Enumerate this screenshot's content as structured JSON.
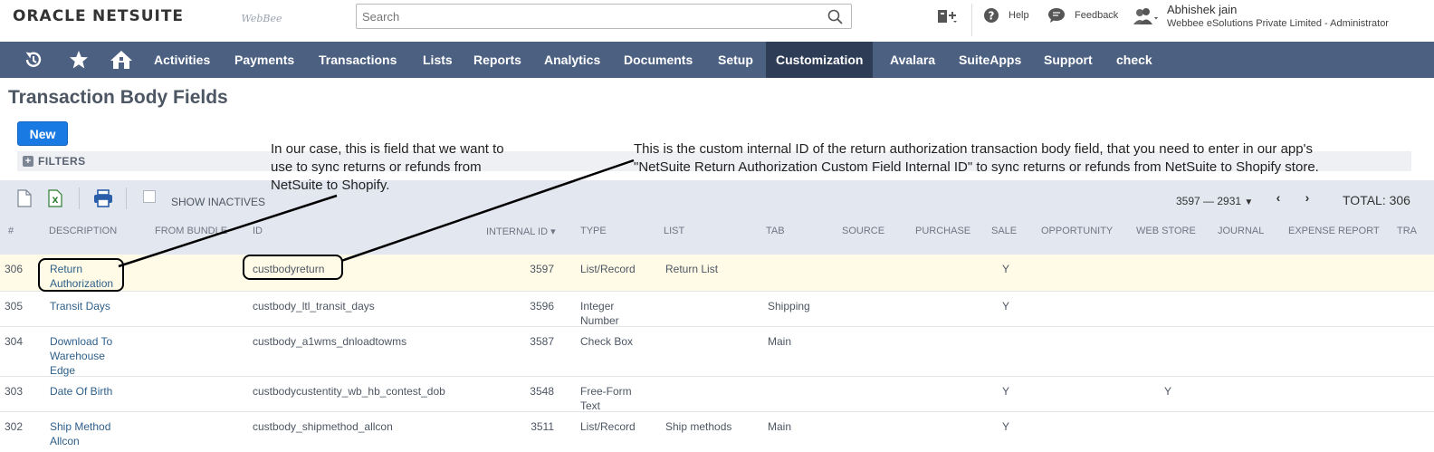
{
  "header": {
    "logo_bold": "ORACLE",
    "logo_light": "NETSUITE",
    "company_logo": "WebBee",
    "search_placeholder": "Search",
    "help": "Help",
    "feedback": "Feedback",
    "user_name": "Abhishek jain",
    "user_role": "Webbee eSolutions Private Limited - Administrator"
  },
  "nav": {
    "items": [
      "Activities",
      "Payments",
      "Transactions",
      "Lists",
      "Reports",
      "Analytics",
      "Documents",
      "Setup",
      "Customization",
      "Avalara",
      "SuiteApps",
      "Support",
      "check"
    ],
    "active": "Customization"
  },
  "page": {
    "title": "Transaction Body Fields",
    "new_button": "New",
    "filters": "FILTERS",
    "show_inactives": "SHOW INACTIVES",
    "pager_range": "3597 — 2931",
    "total": "TOTAL: 306"
  },
  "table": {
    "columns": [
      "#",
      "DESCRIPTION",
      "FROM BUNDLE",
      "ID",
      "INTERNAL ID ▾",
      "TYPE",
      "LIST",
      "TAB",
      "SOURCE",
      "PURCHASE",
      "SALE",
      "OPPORTUNITY",
      "WEB STORE",
      "JOURNAL",
      "EXPENSE REPORT",
      "TRA"
    ],
    "rows": [
      {
        "num": "306",
        "description": "Return\nAuthorization",
        "id": "custbodyreturn",
        "internal_id": "3597",
        "type": "List/Record",
        "list": "Return List",
        "tab": "",
        "sale": "Y",
        "web_store": ""
      },
      {
        "num": "305",
        "description": "Transit Days",
        "id": "custbody_ltl_transit_days",
        "internal_id": "3596",
        "type": "Integer\nNumber",
        "list": "",
        "tab": "Shipping",
        "sale": "Y",
        "web_store": ""
      },
      {
        "num": "304",
        "description": "Download To\nWarehouse\nEdge",
        "id": "custbody_a1wms_dnloadtowms",
        "internal_id": "3587",
        "type": "Check Box",
        "list": "",
        "tab": "Main",
        "sale": "",
        "web_store": ""
      },
      {
        "num": "303",
        "description": "Date Of Birth",
        "id": "custbodycustentity_wb_hb_contest_dob",
        "internal_id": "3548",
        "type": "Free-Form\nText",
        "list": "",
        "tab": "",
        "sale": "Y",
        "web_store": "Y"
      },
      {
        "num": "302",
        "description": "Ship Method\nAllcon",
        "id": "custbody_shipmethod_allcon",
        "internal_id": "3511",
        "type": "List/Record",
        "list": "Ship methods",
        "tab": "Main",
        "sale": "Y",
        "web_store": ""
      }
    ]
  },
  "annotations": {
    "left_note": "In our case, this is field that we want to use to sync returns or refunds from NetSuite to Shopify.",
    "right_note": "This is the custom internal ID of the return authorization transaction body field, that you need to enter in our app's \"NetSuite Return Authorization Custom Field Internal ID\" to sync returns or refunds from NetSuite to Shopify store."
  },
  "colors": {
    "nav_bg": "#4c6082",
    "nav_active": "#2e3c56",
    "button_blue": "#1a7ae3",
    "highlight_row": "#fffbe6",
    "link": "#2e5f8a"
  },
  "icons": [
    "search-icon",
    "recent-icon",
    "star-icon",
    "home-icon",
    "help-icon",
    "feedback-icon",
    "user-icon",
    "export-csv-icon",
    "export-excel-icon",
    "print-icon",
    "prev-page-icon",
    "next-page-icon"
  ]
}
